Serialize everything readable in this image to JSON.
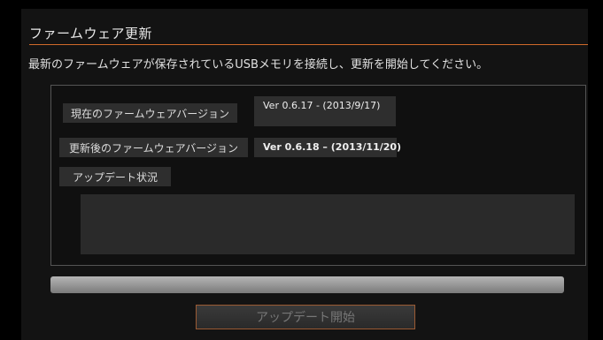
{
  "title": "ファームウェア更新",
  "instructions": "最新のファームウェアが保存されているUSBメモリを接続し、更新を開始してください。",
  "current_version": {
    "label": "現在のファームウェアバージョン",
    "value": "Ver 0.6.17 -  (2013/9/17)"
  },
  "new_version": {
    "label": "更新後のファームウェアバージョン",
    "value": "Ver 0.6.18 – (2013/11/20)"
  },
  "status": {
    "label": "アップデート状況",
    "text": ""
  },
  "progress": {
    "value": 0
  },
  "start_button_label": "アップデート開始",
  "colors": {
    "accent": "#d06a2a",
    "background": "#000000",
    "panel": "#131313"
  }
}
